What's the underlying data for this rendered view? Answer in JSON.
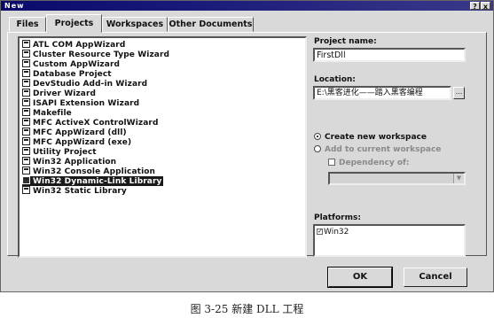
{
  "window": {
    "title": "New"
  },
  "titlebar_buttons": [
    {
      "label": "?"
    },
    {
      "label": "x"
    }
  ],
  "tabs": [
    {
      "label": "Files"
    },
    {
      "label": "Projects"
    },
    {
      "label": "Workspaces"
    },
    {
      "label": "Other Documents"
    }
  ],
  "project_types": [
    "ATL COM AppWizard",
    "Cluster Resource Type Wizard",
    "Custom AppWizard",
    "Database Project",
    "DevStudio Add-in Wizard",
    "Driver Wizard",
    "ISAPI Extension Wizard",
    "Makefile",
    "MFC ActiveX ControlWizard",
    "MFC AppWizard (dll)",
    "MFC AppWizard (exe)",
    "Utility Project",
    "Win32 Application",
    "Win32 Console Application",
    "Win32 Dynamic-Link Library",
    "Win32 Static Library"
  ],
  "selected_project": "Win32 Dynamic-Link Library",
  "project_name": {
    "label": "Project name:",
    "value": "FirstDll"
  },
  "location": {
    "label": "Location:",
    "value": "E:\\黑客进化——踏入黑客编程",
    "browse_label": "..."
  },
  "workspace_options": {
    "create_new": "Create new workspace",
    "add_to_current": "Add to current workspace",
    "dependency": "Dependency of:"
  },
  "platforms": {
    "label": "Platforms:",
    "items": [
      "Win32"
    ]
  },
  "buttons": {
    "ok": "OK",
    "cancel": "Cancel"
  },
  "caption": "图 3-25   新建 DLL 工程"
}
